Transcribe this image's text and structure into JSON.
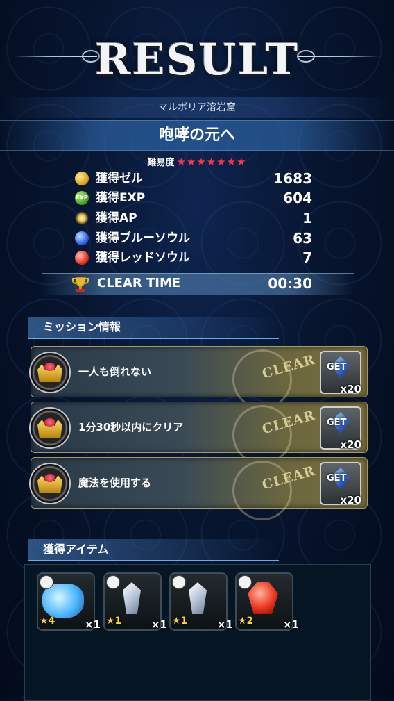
{
  "title": "RESULT",
  "area_name": "マルボリア溶岩窟",
  "stage_name": "咆哮の元へ",
  "difficulty": {
    "label": "難易度",
    "stars": "★★★★★★★"
  },
  "rewards": [
    {
      "label": "獲得ゼル",
      "value": "1683",
      "icon": "gil-coin-icon"
    },
    {
      "label": "獲得EXP",
      "value": "604",
      "icon": "exp-icon"
    },
    {
      "label": "獲得AP",
      "value": "1",
      "icon": "ap-sparkle-icon"
    },
    {
      "label": "獲得ブルーソウル",
      "value": "63",
      "icon": "blue-soul-icon"
    },
    {
      "label": "獲得レッドソウル",
      "value": "7",
      "icon": "red-soul-icon"
    }
  ],
  "clear_time": {
    "label": "CLEAR TIME",
    "value": "00:30"
  },
  "missions_header": "ミッション情報",
  "missions": [
    {
      "text": "一人も倒れない",
      "status": "CLEAR",
      "reward_label": "GET",
      "reward_count": "x20"
    },
    {
      "text": "1分30秒以内にクリア",
      "status": "CLEAR",
      "reward_label": "GET",
      "reward_count": "x20"
    },
    {
      "text": "魔法を使用する",
      "status": "CLEAR",
      "reward_label": "GET",
      "reward_count": "x20"
    }
  ],
  "items_header": "獲得アイテム",
  "items": [
    {
      "rarity": "★4",
      "qty": "×1",
      "icon": "blue-bag-icon"
    },
    {
      "rarity": "★1",
      "qty": "×1",
      "icon": "white-crystal-icon"
    },
    {
      "rarity": "★1",
      "qty": "×1",
      "icon": "white-crystal-icon"
    },
    {
      "rarity": "★2",
      "qty": "×1",
      "icon": "red-crystal-icon"
    }
  ],
  "colors": {
    "accent_blue": "#6aa8e6",
    "star_red": "#ff3348",
    "clear_gold": "#e5d69e"
  }
}
